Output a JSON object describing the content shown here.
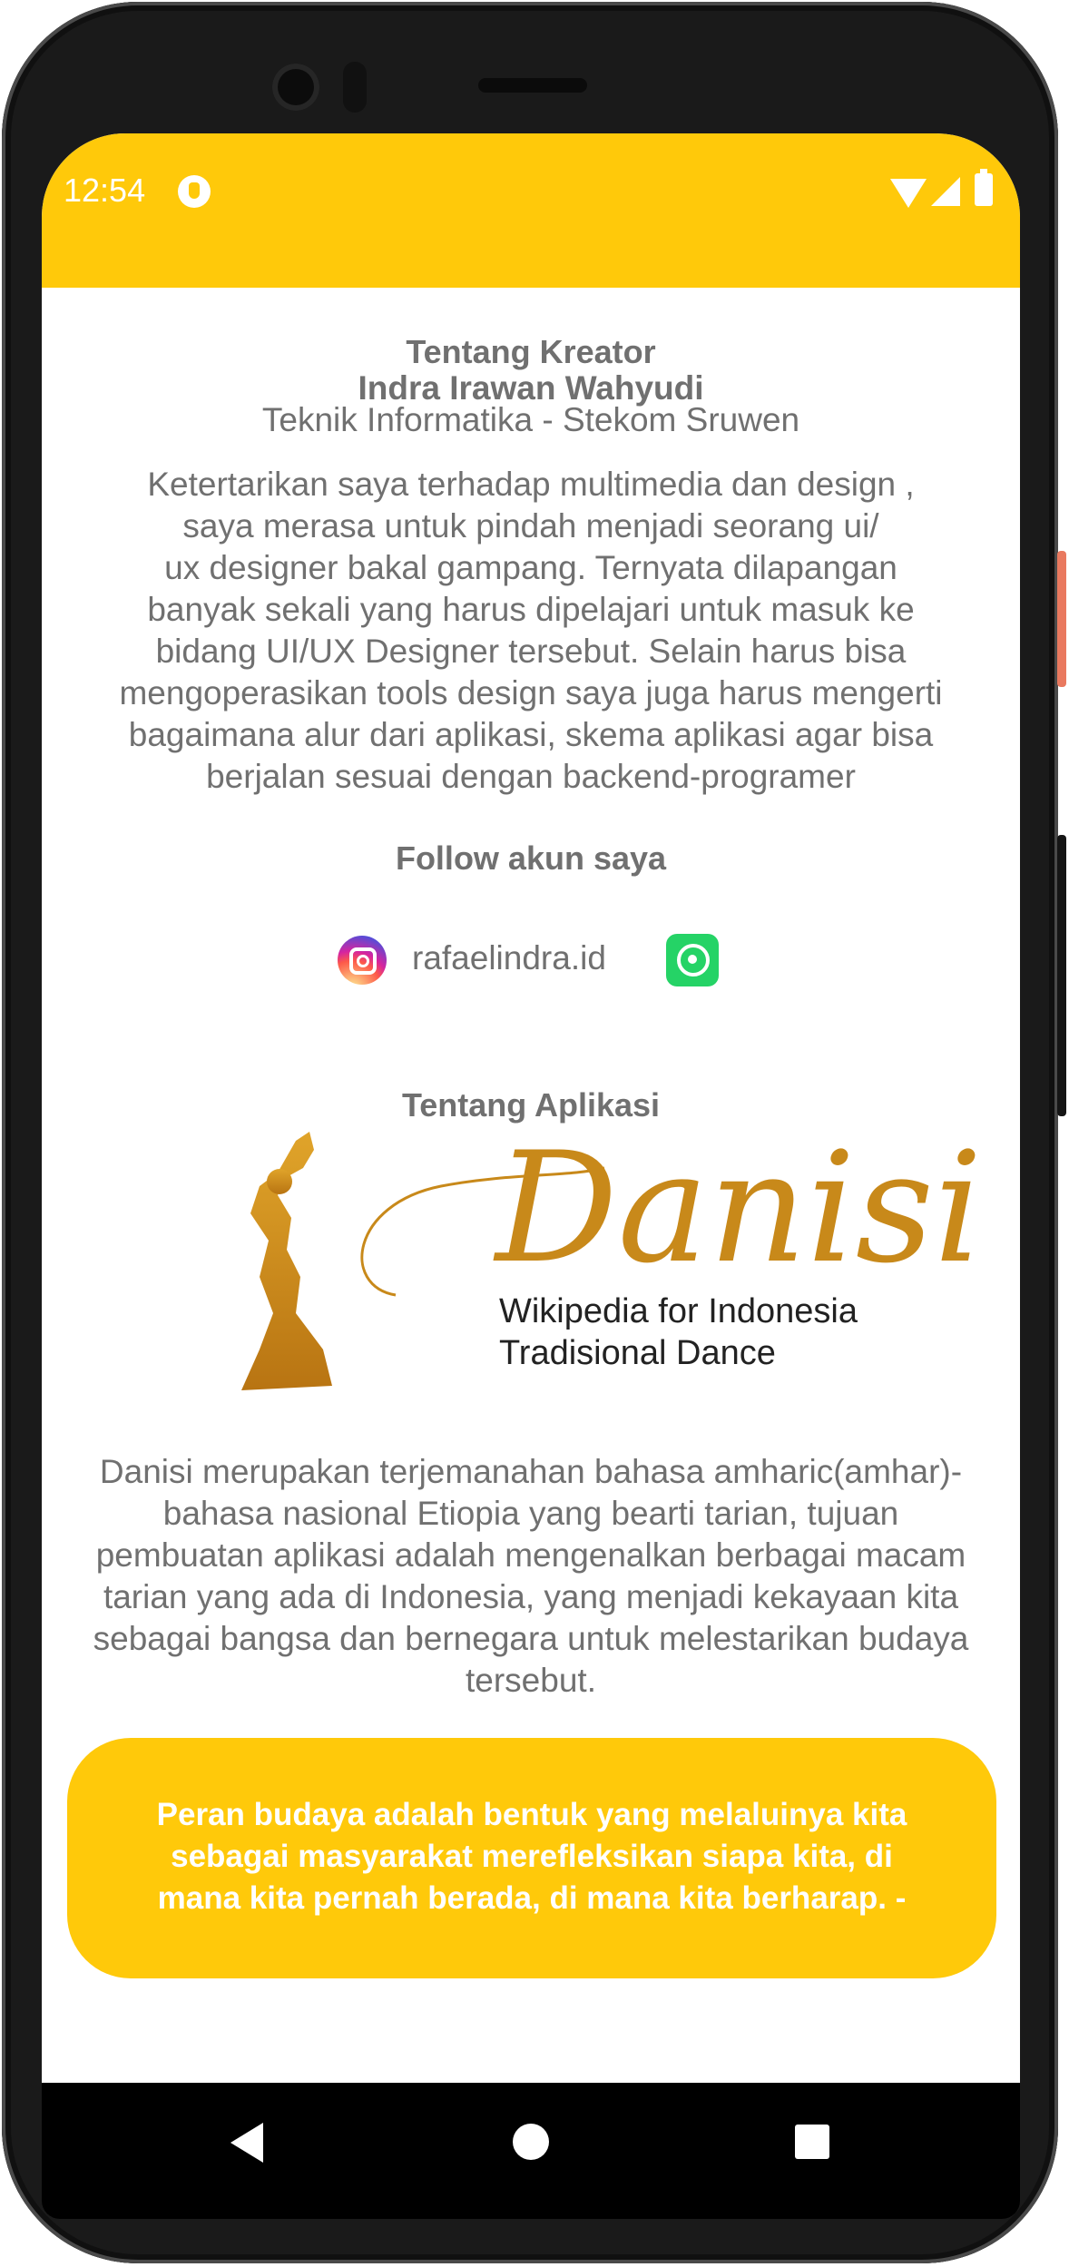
{
  "status_bar": {
    "time": "12:54"
  },
  "creator": {
    "section_title": "Tentang Kreator",
    "name": "Indra Irawan Wahyudi",
    "affiliation": "Teknik Informatika - Stekom Sruwen",
    "bio_lines": [
      "Ketertarikan saya terhadap multimedia dan design ,",
      "saya merasa untuk pindah menjadi seorang ui/",
      "ux designer bakal gampang. Ternyata dilapangan",
      "banyak sekali yang harus dipelajari untuk masuk ke",
      "bidang UI/UX Designer tersebut. Selain harus bisa",
      "mengoperasikan tools design saya juga harus mengerti",
      "bagaimana alur dari aplikasi, skema aplikasi agar bisa",
      "berjalan sesuai dengan backend-programer"
    ]
  },
  "follow": {
    "title": "Follow akun saya",
    "instagram_handle": "rafaelindra.id",
    "icons": [
      "instagram-icon",
      "whatsapp-icon"
    ]
  },
  "app": {
    "section_title": "Tentang Aplikasi",
    "logo_name": "Danisi",
    "logo_tagline_1": "Wikipedia for Indonesia",
    "logo_tagline_2": "Tradisional Dance",
    "description_lines": [
      "Danisi merupakan terjemanahan bahasa amharic(amhar)-",
      "bahasa nasional Etiopia yang bearti tarian, tujuan",
      "pembuatan aplikasi adalah mengenalkan berbagai macam",
      "tarian yang ada di Indonesia, yang menjadi kekayaan kita",
      "sebagai bangsa dan bernegara untuk melestarikan budaya",
      "tersebut."
    ]
  },
  "quote": {
    "lines": [
      "Peran budaya adalah bentuk yang melaluinya kita",
      "sebagai masyarakat merefleksikan siapa kita, di",
      "mana kita pernah berada, di mana kita berharap. -"
    ]
  },
  "colors": {
    "accent": "#ffc90a",
    "text_gray": "#707070",
    "logo_gold": "#c8891a"
  }
}
